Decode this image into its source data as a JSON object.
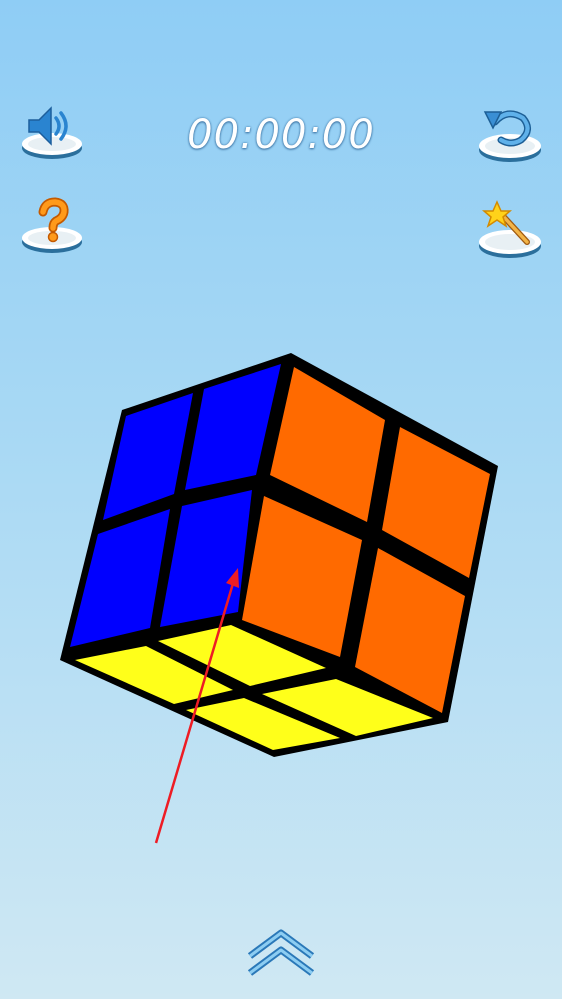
{
  "timer": {
    "value": "00:00:00"
  },
  "toolbar": {
    "sound": {
      "icon": "speaker-icon"
    },
    "undo": {
      "icon": "undo-arrow-icon"
    },
    "help": {
      "icon": "question-mark-icon"
    },
    "hint": {
      "icon": "magic-wand-icon"
    },
    "expand": {
      "icon": "double-chevron-up-icon"
    }
  },
  "cube": {
    "size": "2x2",
    "faces": {
      "left": [
        "blue",
        "blue",
        "blue",
        "blue"
      ],
      "right": [
        "orange",
        "orange",
        "orange",
        "orange"
      ],
      "bottom": [
        "yellow",
        "yellow",
        "yellow",
        "yellow"
      ]
    },
    "colors": {
      "blue": "#0000ff",
      "orange": "#ff6a00",
      "yellow": "#ffff1a",
      "border": "#000000",
      "annotation": "#ee1c24"
    }
  }
}
